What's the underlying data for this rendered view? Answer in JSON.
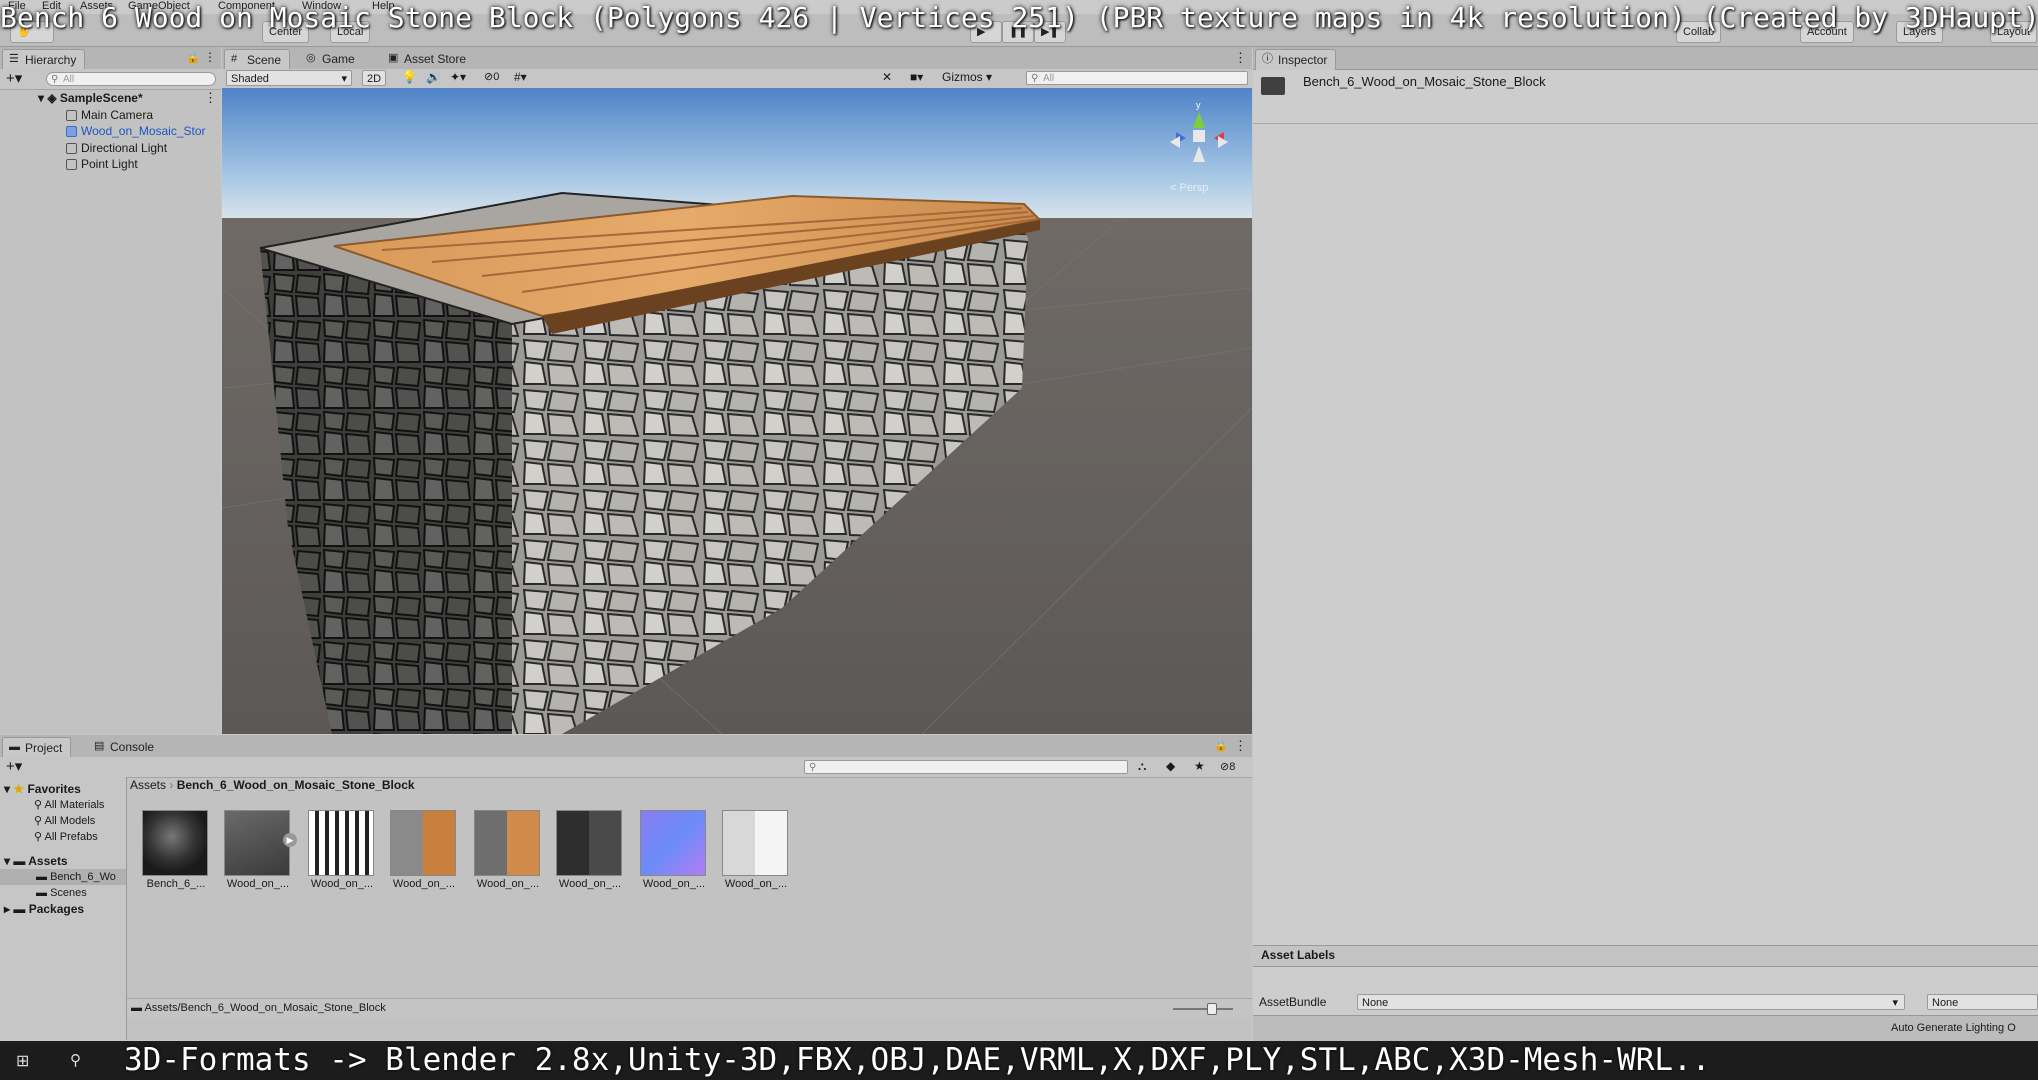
{
  "overlay": {
    "title": "Bench 6 Wood on Mosaic Stone Block (Polygons 426 | Vertices 251) (PBR texture maps in 4k resolution) (Created by 3DHaupt)",
    "caption": "3D-Formats -> Blender 2.8x,Unity-3D,FBX,OBJ,DAE,VRML,X,DXF,PLY,STL,ABC,X3D-Mesh-WRL.."
  },
  "menu": {
    "items": [
      "File",
      "Edit",
      "Assets",
      "GameObject",
      "Component",
      "Window",
      "Help"
    ]
  },
  "toolbar": {
    "pivot": "Center",
    "space": "Local",
    "collab": "Collab",
    "account": "Account",
    "layers": "Layers",
    "layout": "Layout"
  },
  "hierarchy": {
    "tab": "Hierarchy",
    "search_placeholder": "All",
    "scene": "SampleScene*",
    "items": [
      "Main Camera",
      "Wood_on_Mosaic_Stor",
      "Directional Light",
      "Point Light"
    ]
  },
  "scene": {
    "tabs": [
      "Scene",
      "Game",
      "Asset Store"
    ],
    "shading_mode": "Shaded",
    "mode_2d": "2D",
    "hidden_count": "0",
    "gizmos": "Gizmos",
    "search_placeholder": "All",
    "persp": "< Persp"
  },
  "inspector": {
    "tab": "Inspector",
    "asset_name": "Bench_6_Wood_on_Mosaic_Stone_Block",
    "asset_labels": "Asset Labels",
    "assetbundle_label": "AssetBundle",
    "assetbundle_value": "None",
    "assetbundle_variant": "None",
    "status": "Auto Generate Lighting O"
  },
  "project": {
    "tabs": [
      "Project",
      "Console"
    ],
    "hidden_count": "8",
    "favorites": "Favorites",
    "favorite_items": [
      "All Materials",
      "All Models",
      "All Prefabs"
    ],
    "assets_root": "Assets",
    "asset_folders": [
      "Bench_6_Wo",
      "Scenes"
    ],
    "packages": "Packages",
    "breadcrumb_root": "Assets",
    "breadcrumb_current": "Bench_6_Wood_on_Mosaic_Stone_Block",
    "thumbnails": [
      {
        "label": "Bench_6_...",
        "kind": "material"
      },
      {
        "label": "Wood_on_...",
        "kind": "model"
      },
      {
        "label": "Wood_on_...",
        "kind": "albedo-bw"
      },
      {
        "label": "Wood_on_...",
        "kind": "albedo-color"
      },
      {
        "label": "Wood_on_...",
        "kind": "albedo-color2"
      },
      {
        "label": "Wood_on_...",
        "kind": "dark"
      },
      {
        "label": "Wood_on_...",
        "kind": "normal"
      },
      {
        "label": "Wood_on_...",
        "kind": "light"
      }
    ],
    "path": "Assets/Bench_6_Wood_on_Mosaic_Stone_Block"
  },
  "colors": {
    "accent_blue": "#1a55c2",
    "normal_map": "#8a7cf0",
    "wood": "#d99a5a"
  }
}
